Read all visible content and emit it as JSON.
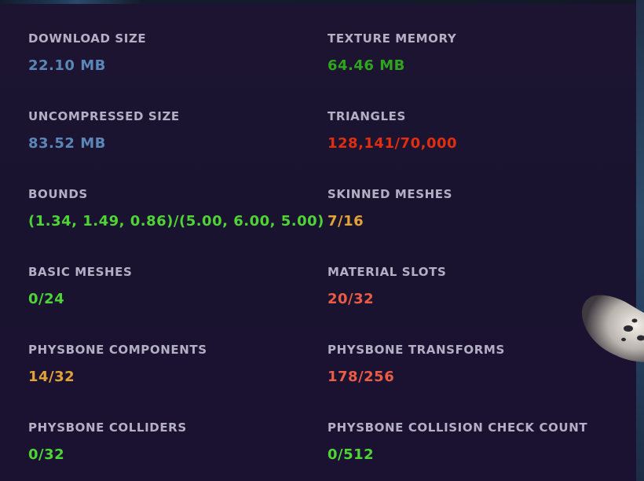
{
  "stats": {
    "download_size": {
      "label": "DOWNLOAD SIZE",
      "value": "22.10 MB",
      "color": "#5b86b8"
    },
    "texture_memory": {
      "label": "TEXTURE MEMORY",
      "value": "64.46 MB",
      "color": "#2fa51d"
    },
    "uncompressed_size": {
      "label": "UNCOMPRESSED SIZE",
      "value": "83.52 MB",
      "color": "#5b86b8"
    },
    "triangles": {
      "label": "TRIANGLES",
      "value": "128,141/70,000",
      "color": "#e02e10"
    },
    "bounds": {
      "label": "BOUNDS",
      "value": "(1.34, 1.49, 0.86)/(5.00, 6.00, 5.00)",
      "color": "#4fd436"
    },
    "skinned_meshes": {
      "label": "SKINNED MESHES",
      "value": "7/16",
      "color": "#e2a336"
    },
    "basic_meshes": {
      "label": "BASIC MESHES",
      "value": "0/24",
      "color": "#4fd436"
    },
    "material_slots": {
      "label": "MATERIAL SLOTS",
      "value": "20/32",
      "color": "#ea5c44"
    },
    "physbone_components": {
      "label": "PHYSBONE COMPONENTS",
      "value": "14/32",
      "color": "#e2a336"
    },
    "physbone_transforms": {
      "label": "PHYSBONE TRANSFORMS",
      "value": "178/256",
      "color": "#ea5c44"
    },
    "physbone_colliders": {
      "label": "PHYSBONE COLLIDERS",
      "value": "0/32",
      "color": "#4fd436"
    },
    "physbone_collision_check_count": {
      "label": "PHYSBONE COLLISION CHECK COUNT",
      "value": "0/512",
      "color": "#4fd436"
    }
  }
}
